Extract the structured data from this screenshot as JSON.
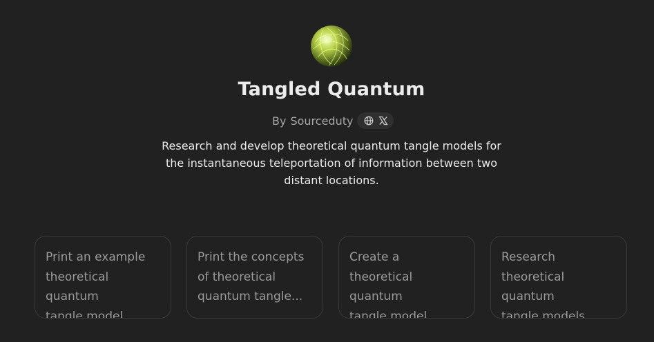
{
  "gpt": {
    "name": "Tangled Quantum",
    "author_prefix": "By",
    "author": "Sourceduty",
    "description": "Research and develop theoretical quantum tangle models for the instantaneous teleportation of information between two distant locations.",
    "social_icons": [
      "globe-icon",
      "x-logo-icon"
    ]
  },
  "starters": [
    {
      "label": "Print an example\ntheoretical quantum\ntangle model."
    },
    {
      "label": "Print the concepts\nof theoretical\nquantum tangle..."
    },
    {
      "label": "Create a theoretical\nquantum\ntangle model."
    },
    {
      "label": "Research theoretical\nquantum\ntangle models."
    }
  ],
  "colors": {
    "background": "#212121",
    "title": "#ececec",
    "muted": "#a8a8a8",
    "card_border": "#3a3a3a",
    "card_text": "#9b9b9b",
    "avatar_accent": "#c9e36a"
  }
}
